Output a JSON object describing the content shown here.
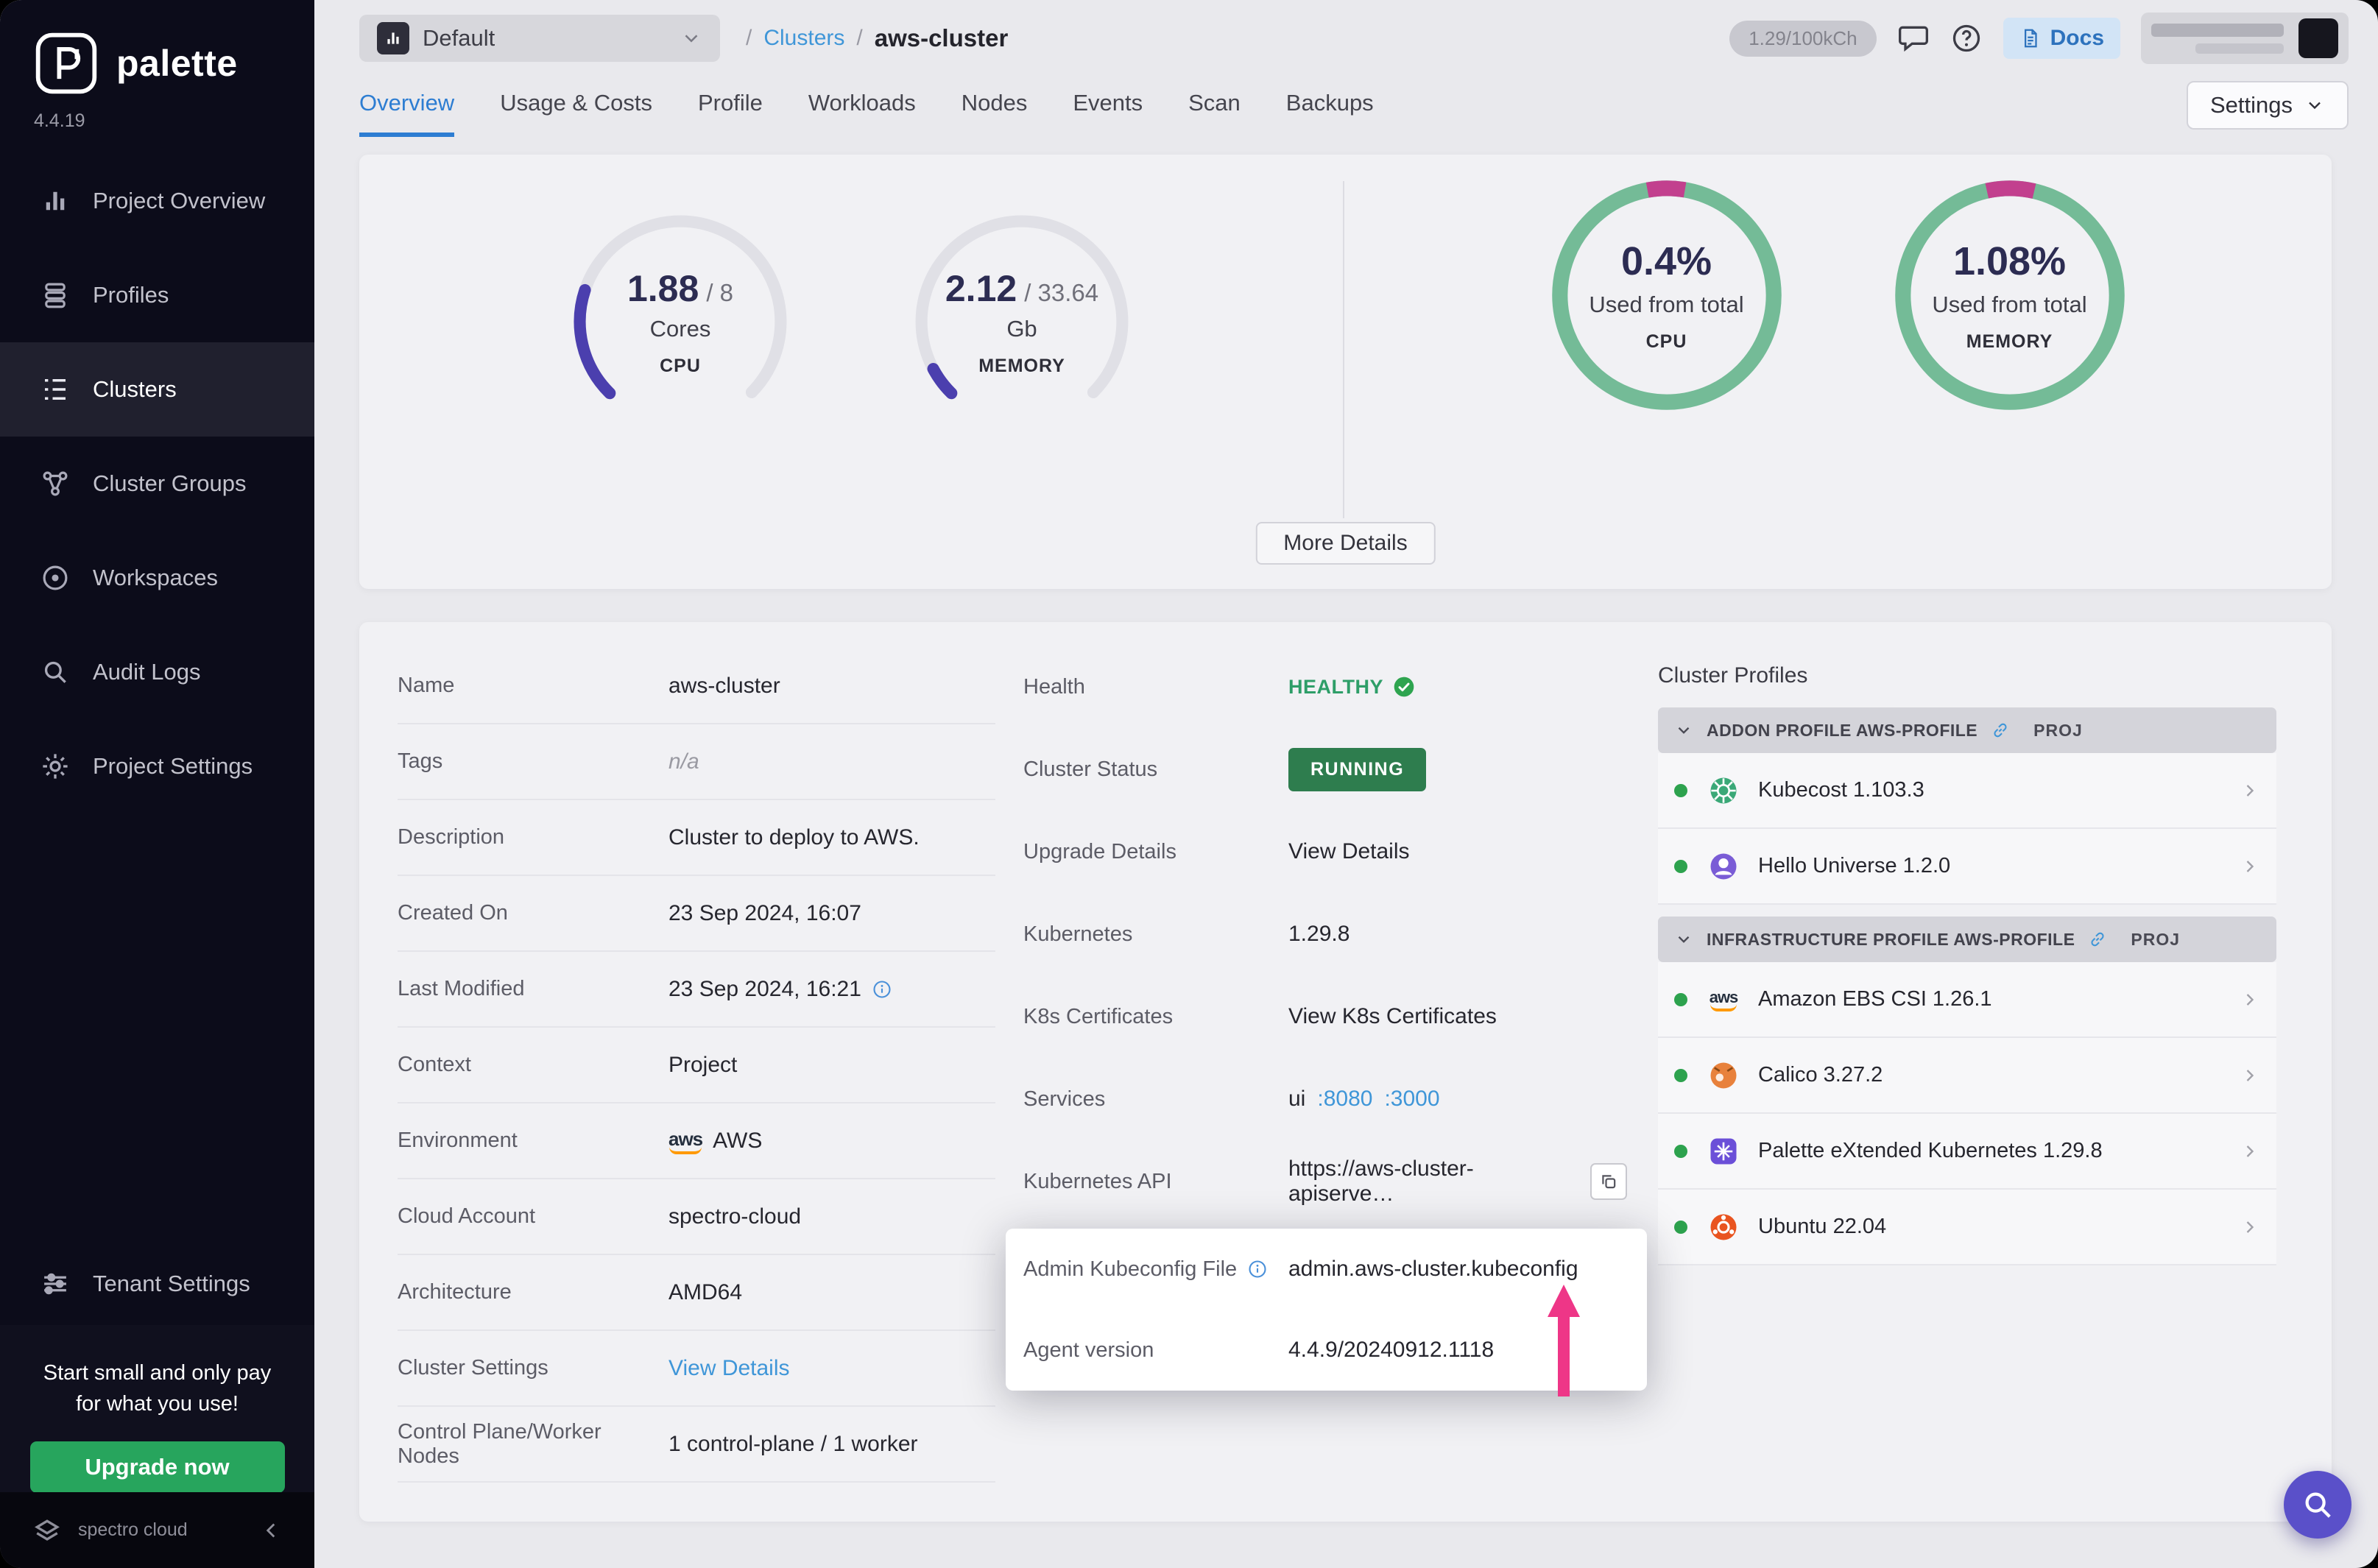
{
  "colors": {
    "accent_blue": "#2d7dd2",
    "link_blue": "#3f96d8",
    "healthy_green": "#2e9e68",
    "running_badge_green": "#2e7d4e",
    "gauge_purple": "#4b3fae",
    "usage_ring_teal": "#74bb97",
    "usage_ring_magenta": "#c2408e",
    "annotation_pink": "#ee3687",
    "upgrade_green": "#27a55d"
  },
  "sidebar": {
    "logo_text": "palette",
    "version": "4.4.19",
    "items": [
      {
        "label": "Project Overview",
        "icon": "bar-chart-icon",
        "active": false
      },
      {
        "label": "Profiles",
        "icon": "layers-icon",
        "active": false
      },
      {
        "label": "Clusters",
        "icon": "clusters-list-icon",
        "active": true
      },
      {
        "label": "Cluster Groups",
        "icon": "nodes-icon",
        "active": false
      },
      {
        "label": "Workspaces",
        "icon": "target-icon",
        "active": false
      },
      {
        "label": "Audit Logs",
        "icon": "magnifier-icon",
        "active": false
      },
      {
        "label": "Project Settings",
        "icon": "gear-icon",
        "active": false
      }
    ],
    "tenant_settings_label": "Tenant Settings",
    "promo_line1": "Start small and only pay",
    "promo_line2": "for what you use!",
    "upgrade_button": "Upgrade now",
    "brand": "spectro cloud"
  },
  "header": {
    "project_selector": "Default",
    "breadcrumb_root": "/",
    "breadcrumb_link": "Clusters",
    "breadcrumb_sep": "/",
    "breadcrumb_current": "aws-cluster",
    "usage_pill": "1.29/100kCh",
    "docs_label": "Docs"
  },
  "tabs": {
    "active": "Overview",
    "items": [
      "Overview",
      "Usage & Costs",
      "Profile",
      "Workloads",
      "Nodes",
      "Events",
      "Scan",
      "Backups"
    ]
  },
  "toolbar": {
    "settings_label": "Settings"
  },
  "metrics": {
    "cpu_gauge": {
      "value": "1.88",
      "total": "/ 8",
      "unit": "Cores",
      "label": "CPU",
      "fraction": 0.235
    },
    "memory_gauge": {
      "value": "2.12",
      "total": "/ 33.64",
      "unit": "Gb",
      "label": "MEMORY",
      "fraction": 0.063
    },
    "cpu_usage": {
      "percent": "0.4%",
      "caption": "Used from total",
      "label": "CPU"
    },
    "memory_usage": {
      "percent": "1.08%",
      "caption": "Used from total",
      "label": "MEMORY"
    },
    "more_details_button": "More Details"
  },
  "details": {
    "rows": [
      {
        "label": "Name",
        "value": "aws-cluster"
      },
      {
        "label": "Tags",
        "value": "n/a"
      },
      {
        "label": "Description",
        "value": "Cluster to deploy to AWS."
      },
      {
        "label": "Created On",
        "value": "23 Sep 2024, 16:07"
      },
      {
        "label": "Last Modified",
        "value": "23 Sep 2024, 16:21"
      },
      {
        "label": "Context",
        "value": "Project"
      },
      {
        "label": "Environment",
        "value": "AWS"
      },
      {
        "label": "Cloud Account",
        "value": "spectro-cloud"
      },
      {
        "label": "Architecture",
        "value": "AMD64"
      },
      {
        "label": "Cluster Settings",
        "value": "View Details"
      },
      {
        "label": "Control Plane/Worker Nodes",
        "value": "1 control-plane / 1 worker"
      }
    ]
  },
  "status": {
    "health_label": "Health",
    "health_value": "HEALTHY",
    "cluster_status_label": "Cluster Status",
    "cluster_status_value": "RUNNING",
    "upgrade_label": "Upgrade Details",
    "upgrade_value": "View Details",
    "kubernetes_label": "Kubernetes",
    "kubernetes_value": "1.29.8",
    "certs_label": "K8s Certificates",
    "certs_value": "View K8s Certificates",
    "services_label": "Services",
    "services_prefix": "ui",
    "services_ports": [
      ":8080",
      ":3000"
    ],
    "api_label": "Kubernetes API",
    "api_value": "https://aws-cluster-apiserve…",
    "kubeconfig_label": "Admin Kubeconfig File",
    "kubeconfig_value": "admin.aws-cluster.kubeconfig",
    "agent_label": "Agent version",
    "agent_value": "4.4.9/20240912.1118"
  },
  "cluster_profiles": {
    "title": "Cluster Profiles",
    "sections": [
      {
        "header": "ADDON PROFILE AWS-PROFILE",
        "badge": "PROJ",
        "items": [
          {
            "name": "Kubecost 1.103.3",
            "icon": "kubecost-icon"
          },
          {
            "name": "Hello Universe 1.2.0",
            "icon": "hello-universe-icon"
          }
        ]
      },
      {
        "header": "INFRASTRUCTURE PROFILE AWS-PROFILE",
        "badge": "PROJ",
        "items": [
          {
            "name": "Amazon EBS CSI 1.26.1",
            "icon": "aws-icon"
          },
          {
            "name": "Calico 3.27.2",
            "icon": "calico-icon"
          },
          {
            "name": "Palette eXtended Kubernetes 1.29.8",
            "icon": "pxk-icon"
          },
          {
            "name": "Ubuntu 22.04",
            "icon": "ubuntu-icon"
          }
        ]
      }
    ]
  }
}
